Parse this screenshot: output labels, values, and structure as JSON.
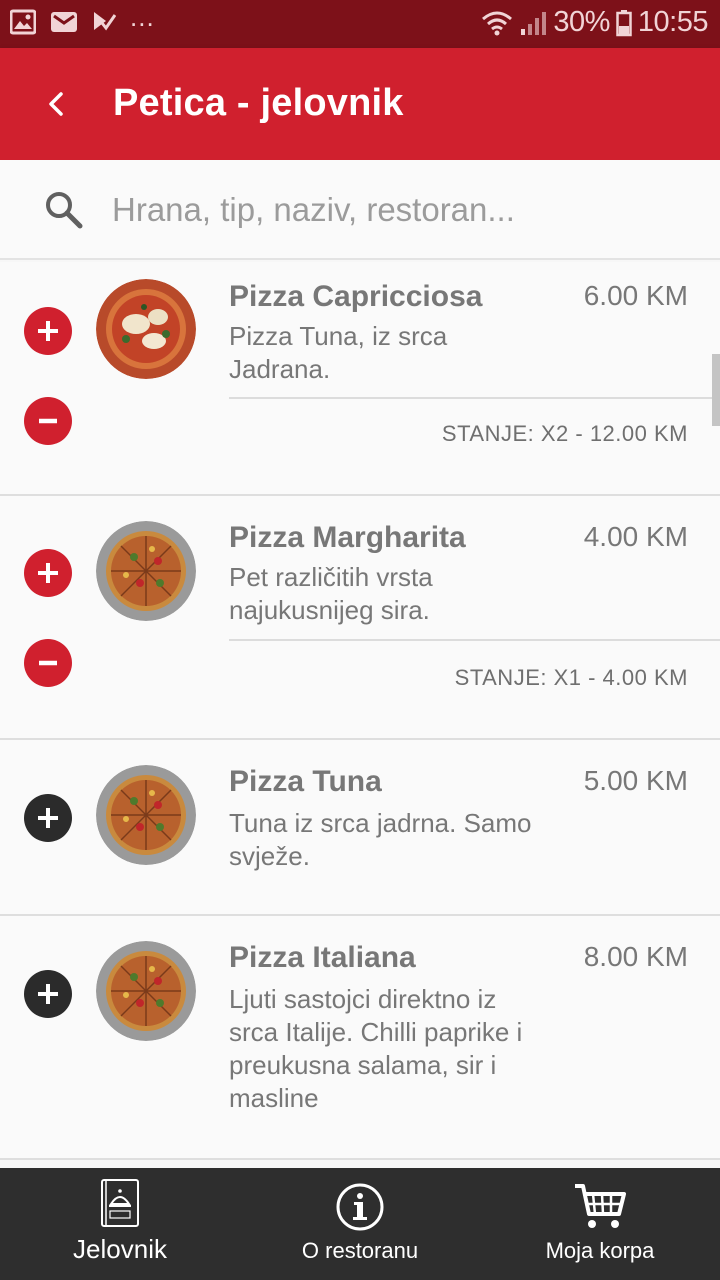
{
  "status_bar": {
    "more": "...",
    "battery_percent": "30%",
    "time": "10:55"
  },
  "header": {
    "title": "Petica - jelovnik",
    "back_icon": "back-arrow-icon"
  },
  "search": {
    "placeholder": "Hrana, tip, naziv, restoran..."
  },
  "items": [
    {
      "name": "Pizza Capricciosa",
      "price": "6.00 KM",
      "desc": "Pizza Tuna, iz srca Jadrana.",
      "stanje": "STANJE: X2 - 12.00 KM"
    },
    {
      "name": "Pizza Margharita",
      "price": "4.00 KM",
      "desc": "Pet različitih vrsta najukusnijeg sira.",
      "stanje": "STANJE: X1 - 4.00 KM"
    },
    {
      "name": "Pizza Tuna",
      "price": "5.00 KM",
      "desc": "Tuna iz srca jadrna. Samo svježe."
    },
    {
      "name": "Pizza Italiana",
      "price": "8.00 KM",
      "desc": "Ljuti sastojci direktno iz srca Italije. Chilli paprike i preukusna salama, sir i masline"
    }
  ],
  "bottom_nav": {
    "menu": "Jelovnik",
    "about": "O restoranu",
    "cart": "Moja korpa"
  },
  "colors": {
    "primary": "#d0202e",
    "status_bar": "#7d1119",
    "nav_bg": "#2e2e2e",
    "add_inactive": "#2b2b2b"
  }
}
